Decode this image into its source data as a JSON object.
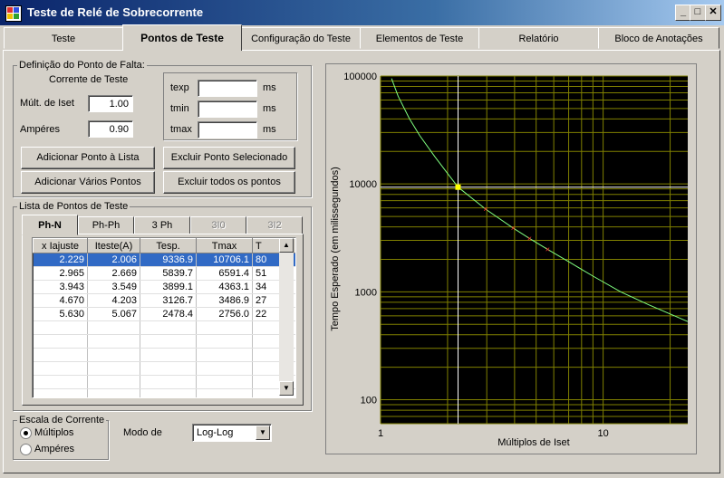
{
  "window": {
    "title": "Teste de Relé de Sobrecorrente"
  },
  "tabs": [
    "Teste",
    "Pontos de Teste",
    "Configuração do Teste",
    "Elementos de Teste",
    "Relatório",
    "Bloco de Anotações"
  ],
  "fault_point": {
    "legend": "Definição do Ponto de Falta:",
    "current_title": "Corrente de Teste",
    "mult_label": "Múlt. de Iset",
    "mult_value": "1.00",
    "amps_label": "Ampéres",
    "amps_value": "0.90",
    "texp_label": "texp",
    "tmin_label": "tmin",
    "tmax_label": "tmax",
    "unit": "ms",
    "btn_add_point": "Adicionar Ponto à Lista",
    "btn_remove_selected": "Excluir Ponto Selecionado",
    "btn_add_multiple": "Adicionar Vários Pontos",
    "btn_remove_all": "Excluir todos os pontos"
  },
  "point_list": {
    "legend": "Lista de Pontos de Teste",
    "subtabs": [
      "Ph-N",
      "Ph-Ph",
      "3 Ph",
      "3I0",
      "3I2"
    ],
    "columns": [
      "x Iajuste",
      "Iteste(A)",
      "Tesp.",
      "Tmax",
      "T"
    ],
    "rows": [
      [
        "2.229",
        "2.006",
        "9336.9",
        "10706.1",
        "80"
      ],
      [
        "2.965",
        "2.669",
        "5839.7",
        "6591.4",
        "51"
      ],
      [
        "3.943",
        "3.549",
        "3899.1",
        "4363.1",
        "34"
      ],
      [
        "4.670",
        "4.203",
        "3126.7",
        "3486.9",
        "27"
      ],
      [
        "5.630",
        "5.067",
        "2478.4",
        "2756.0",
        "22"
      ]
    ]
  },
  "scale": {
    "legend": "Escala de Corrente",
    "opt_multiples": "Múltiplos",
    "opt_amps": "Ampéres",
    "mode_label": "Modo de",
    "mode_value": "Log-Log"
  },
  "colors": {
    "titlebar": "#0a246a",
    "plot_bg": "#000000",
    "grid": "#808000",
    "curve": "#80ff80",
    "point": "#ff3030",
    "selected": "#ffff00"
  },
  "chart_data": {
    "type": "scatter",
    "xlabel": "Múltiplos de Iset",
    "ylabel": "Tempo Esperado (em milissegundos)",
    "xscale": "log",
    "yscale": "log",
    "xlim": [
      1,
      24
    ],
    "ylim": [
      60,
      100000
    ],
    "x_ticks": [
      "1",
      "10"
    ],
    "y_ticks": [
      "100",
      "1000",
      "10000",
      "100000"
    ],
    "grid": true,
    "points": [
      {
        "x": 2.229,
        "y": 9336.9
      },
      {
        "x": 2.965,
        "y": 5839.7
      },
      {
        "x": 3.943,
        "y": 3899.1
      },
      {
        "x": 4.67,
        "y": 3126.7
      },
      {
        "x": 5.63,
        "y": 2478.4
      }
    ],
    "selected_point": {
      "x": 2.229,
      "y": 9336.9
    },
    "curve": [
      {
        "x": 1.12,
        "y": 95000
      },
      {
        "x": 1.2,
        "y": 65000
      },
      {
        "x": 1.35,
        "y": 40000
      },
      {
        "x": 1.5,
        "y": 28000
      },
      {
        "x": 1.75,
        "y": 18000
      },
      {
        "x": 2.0,
        "y": 12500
      },
      {
        "x": 2.229,
        "y": 9336.9
      },
      {
        "x": 2.965,
        "y": 5839.7
      },
      {
        "x": 3.943,
        "y": 3899.1
      },
      {
        "x": 4.67,
        "y": 3126.7
      },
      {
        "x": 5.63,
        "y": 2478.4
      },
      {
        "x": 7.0,
        "y": 1900
      },
      {
        "x": 9.0,
        "y": 1400
      },
      {
        "x": 12.0,
        "y": 1000
      },
      {
        "x": 16.0,
        "y": 760
      },
      {
        "x": 24.0,
        "y": 530
      }
    ]
  }
}
